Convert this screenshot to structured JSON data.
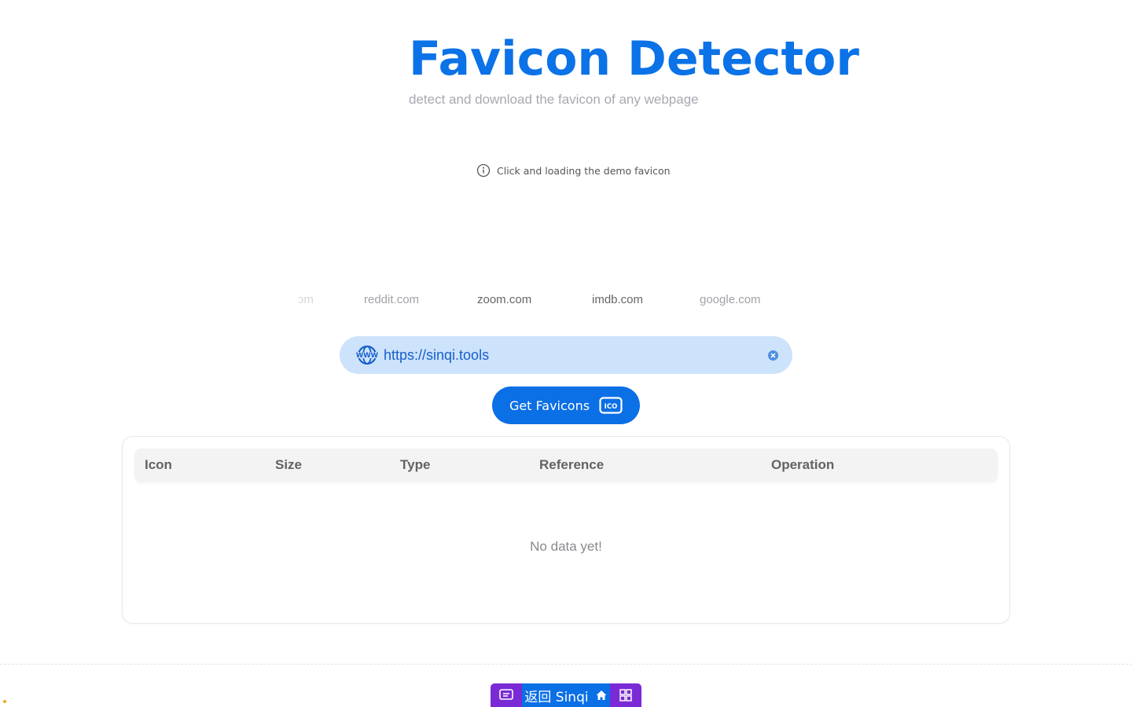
{
  "header": {
    "title": "Favicon Detector",
    "subtitle": "detect and download the favicon of any webpage"
  },
  "demo_hint": {
    "icon": "info-circle-icon",
    "text": "Click and loading the demo favicon"
  },
  "demo_sites": [
    {
      "label": "om",
      "emphasis": "faded"
    },
    {
      "label": "reddit.com",
      "emphasis": "light"
    },
    {
      "label": "zoom.com",
      "emphasis": "strong"
    },
    {
      "label": "imdb.com",
      "emphasis": "strong"
    },
    {
      "label": "google.com",
      "emphasis": "light"
    }
  ],
  "url_input": {
    "value": "https://sinqi.tools",
    "icon": "www-globe-icon",
    "clear_icon": "clear-x-icon"
  },
  "get_button": {
    "label": "Get Favicons",
    "icon": "ico-file-icon"
  },
  "table": {
    "columns": [
      "Icon",
      "Size",
      "Type",
      "Reference",
      "Operation"
    ],
    "empty_text": "No data yet!"
  },
  "footer_bar": {
    "label": "返回 Sinqi",
    "left_icon": "message-icon",
    "home_icon": "home-icon",
    "right_icon": "grid-icon"
  },
  "colors": {
    "accent": "#0b72e7",
    "input_bg": "#cde2fb",
    "footer_purple": "#7a2bd6",
    "subtitle_gray": "#a8a8b3"
  }
}
